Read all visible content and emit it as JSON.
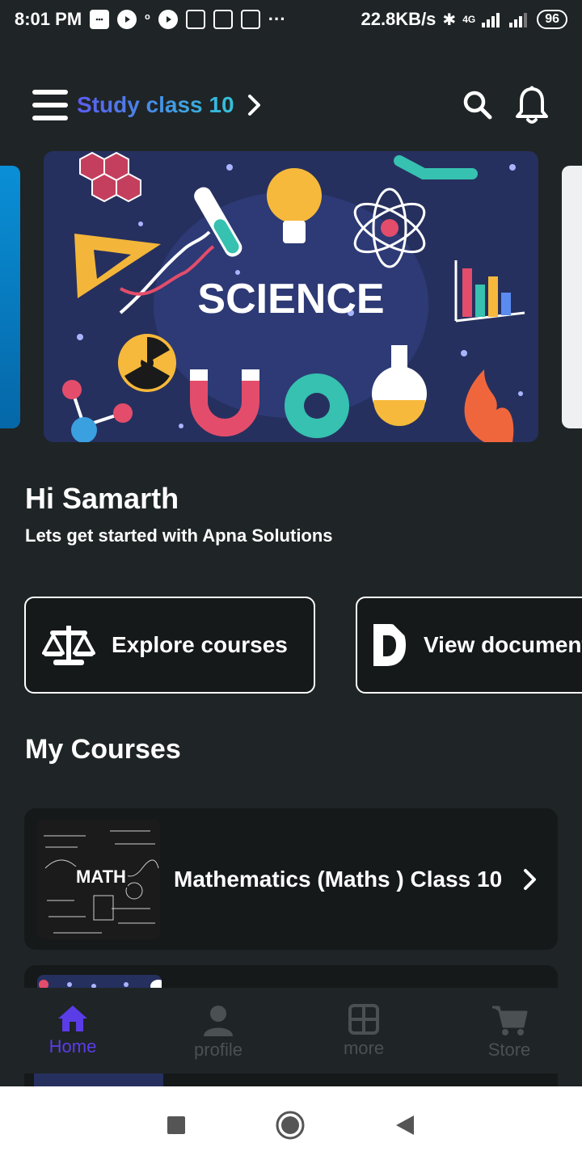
{
  "status_bar": {
    "time": "8:01 PM",
    "net_speed": "22.8KB/s",
    "signal_label": "4G",
    "battery": "96"
  },
  "header": {
    "title": "Study class 10"
  },
  "banner": {
    "text": "SCIENCE"
  },
  "greeting": {
    "hello": "Hi  Samarth",
    "subtitle": "Lets get started with Apna Solutions"
  },
  "quick_actions": [
    {
      "label": "Explore courses",
      "icon": "balance-scale-icon"
    },
    {
      "label": "View documents",
      "icon": "document-icon"
    }
  ],
  "my_courses": {
    "title": "My Courses",
    "items": [
      {
        "name": "Mathematics (Maths ) Class 10",
        "thumb_label": "MATH"
      }
    ]
  },
  "bottom_nav": [
    {
      "label": "Home",
      "icon": "home-icon",
      "active": true
    },
    {
      "label": "profile",
      "icon": "profile-icon",
      "active": false
    },
    {
      "label": "more",
      "icon": "grid-icon",
      "active": false
    },
    {
      "label": "Store",
      "icon": "cart-icon",
      "active": false
    }
  ],
  "colors": {
    "background": "#1f2426",
    "card": "#15191a",
    "accent": "#5b3de8",
    "title_gradient_start": "#5b5cf0",
    "title_gradient_end": "#32c3d8",
    "inactive_nav": "#4b5052"
  }
}
